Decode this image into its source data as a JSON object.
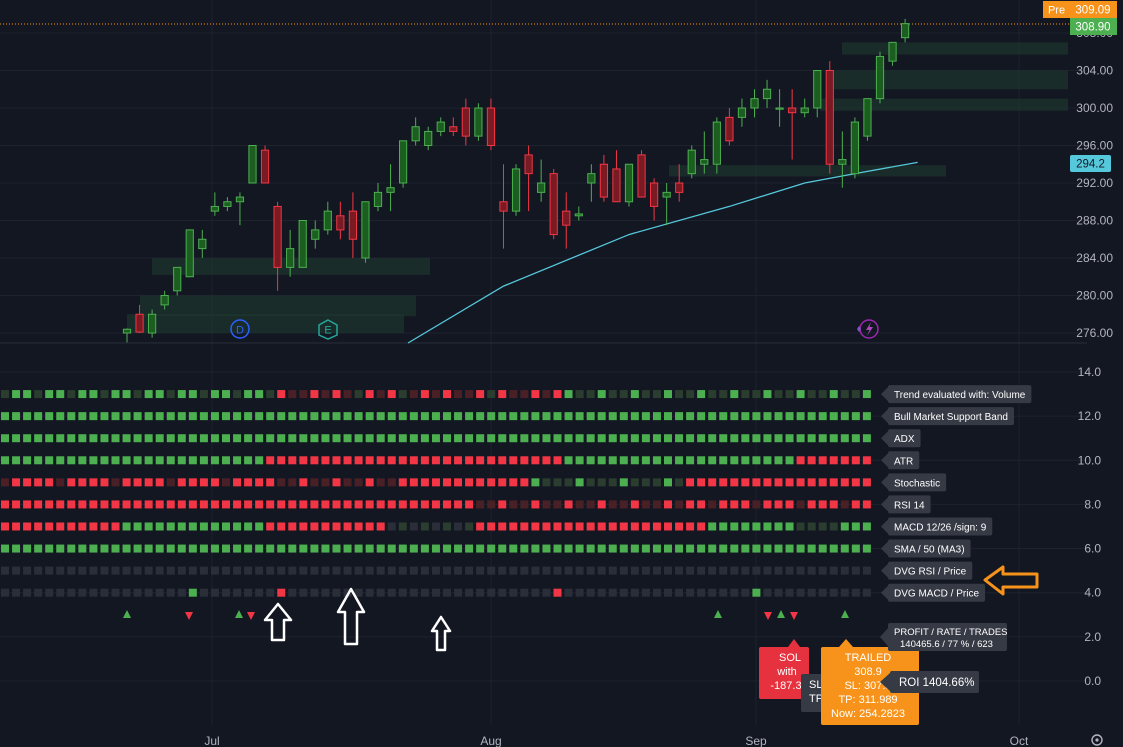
{
  "price_axis": {
    "ticks": [
      "308.00",
      "304.00",
      "300.00",
      "296.00",
      "292.00",
      "288.00",
      "284.00",
      "280.00",
      "276.00"
    ],
    "pre_tag": "Pre",
    "pre_price": "309.09",
    "last_price": "308.90",
    "ma_price": "294.2"
  },
  "indicator_axis": {
    "ticks": [
      "14.0",
      "12.0",
      "10.0",
      "8.0",
      "6.0",
      "4.0",
      "2.0",
      "0.0"
    ]
  },
  "time_axis": [
    "Jul",
    "Aug",
    "Sep",
    "Oct"
  ],
  "markers": {
    "dividend": "D",
    "earnings": "E"
  },
  "indicator_rows": [
    "Trend evaluated with: Volume",
    "Bull Market Support Band",
    "ADX",
    "ATR",
    "Stochastic",
    "RSI 14",
    "MACD  12/26 /sign: 9",
    "SMA / 50 (MA3)",
    "DVG RSI / Price",
    "DVG MACD / Price"
  ],
  "stats": {
    "profit_label": "PROFIT / RATE / TRADES",
    "profit_value": "140465.6 / 77 % / 623",
    "roi": "ROI 1404.66%"
  },
  "trade_labels": {
    "sold_lines": [
      "SOL",
      "with",
      "-187.3"
    ],
    "sl_lines": [
      "SL",
      "TP"
    ],
    "trailed_lines": [
      "TRAILED",
      "308.9",
      "SL: 307.3",
      "TP: 311.989",
      "Now: 254.2823"
    ]
  },
  "colors": {
    "background": "#131722",
    "bull": "#4caf50",
    "bear": "#f23645",
    "ma_line": "#56c8dc",
    "trailed": "#f7931a",
    "arrow": "#f7931a"
  },
  "chart_data": {
    "type": "candlestick",
    "x_axis_ticks": [
      "Jul",
      "Aug",
      "Sep",
      "Oct"
    ],
    "y_axis_ticks": [
      276,
      280,
      284,
      288,
      292,
      296,
      300,
      304,
      308
    ],
    "candles": [
      {
        "o": 276,
        "h": 276.5,
        "l": 275,
        "c": 276.4
      },
      {
        "o": 278,
        "h": 279,
        "l": 276,
        "c": 276.1
      },
      {
        "o": 276,
        "h": 278.5,
        "l": 275.5,
        "c": 278
      },
      {
        "o": 279,
        "h": 280.5,
        "l": 278.5,
        "c": 280
      },
      {
        "o": 280.5,
        "h": 283,
        "l": 280,
        "c": 283
      },
      {
        "o": 282,
        "h": 287,
        "l": 282,
        "c": 287
      },
      {
        "o": 285,
        "h": 287,
        "l": 284,
        "c": 286
      },
      {
        "o": 289,
        "h": 291,
        "l": 288.5,
        "c": 289.5
      },
      {
        "o": 289.5,
        "h": 290.5,
        "l": 289,
        "c": 290
      },
      {
        "o": 290,
        "h": 291,
        "l": 287.5,
        "c": 290.5
      },
      {
        "o": 292,
        "h": 296,
        "l": 292,
        "c": 296
      },
      {
        "o": 295.5,
        "h": 296,
        "l": 292,
        "c": 292
      },
      {
        "o": 289.5,
        "h": 290,
        "l": 280.5,
        "c": 283
      },
      {
        "o": 283,
        "h": 287,
        "l": 282,
        "c": 285
      },
      {
        "o": 283,
        "h": 288,
        "l": 283,
        "c": 288
      },
      {
        "o": 286,
        "h": 288,
        "l": 285,
        "c": 287
      },
      {
        "o": 287,
        "h": 290,
        "l": 286.5,
        "c": 289
      },
      {
        "o": 288.5,
        "h": 290,
        "l": 286,
        "c": 287
      },
      {
        "o": 289,
        "h": 291,
        "l": 284,
        "c": 286
      },
      {
        "o": 284,
        "h": 290,
        "l": 283.5,
        "c": 290
      },
      {
        "o": 289.5,
        "h": 292,
        "l": 289,
        "c": 291
      },
      {
        "o": 291,
        "h": 294,
        "l": 289,
        "c": 291.5
      },
      {
        "o": 292,
        "h": 296.5,
        "l": 291.5,
        "c": 296.5
      },
      {
        "o": 296.5,
        "h": 299,
        "l": 296,
        "c": 298
      },
      {
        "o": 296,
        "h": 298,
        "l": 295.5,
        "c": 297.5
      },
      {
        "o": 297.5,
        "h": 299,
        "l": 297,
        "c": 298.5
      },
      {
        "o": 298,
        "h": 299,
        "l": 297,
        "c": 297.5
      },
      {
        "o": 300,
        "h": 301,
        "l": 296,
        "c": 297
      },
      {
        "o": 297,
        "h": 300.5,
        "l": 296.5,
        "c": 300
      },
      {
        "o": 300,
        "h": 301,
        "l": 295.5,
        "c": 296
      },
      {
        "o": 290,
        "h": 294,
        "l": 285,
        "c": 289
      },
      {
        "o": 289,
        "h": 294,
        "l": 288.5,
        "c": 293.5
      },
      {
        "o": 295,
        "h": 296,
        "l": 289,
        "c": 293
      },
      {
        "o": 291,
        "h": 294.5,
        "l": 290,
        "c": 292
      },
      {
        "o": 293,
        "h": 293.5,
        "l": 286,
        "c": 286.5
      },
      {
        "o": 289,
        "h": 291,
        "l": 285,
        "c": 287.5
      },
      {
        "o": 288.5,
        "h": 289.5,
        "l": 288,
        "c": 288.7
      },
      {
        "o": 292,
        "h": 294,
        "l": 290,
        "c": 293
      },
      {
        "o": 294,
        "h": 295,
        "l": 290,
        "c": 290.5
      },
      {
        "o": 293.5,
        "h": 295.5,
        "l": 290,
        "c": 290
      },
      {
        "o": 290,
        "h": 294,
        "l": 289.5,
        "c": 294
      },
      {
        "o": 295,
        "h": 295.5,
        "l": 290.5,
        "c": 290.5
      },
      {
        "o": 292,
        "h": 292.5,
        "l": 288,
        "c": 289.5
      },
      {
        "o": 290.5,
        "h": 292,
        "l": 287.5,
        "c": 291
      },
      {
        "o": 292,
        "h": 294,
        "l": 290,
        "c": 291
      },
      {
        "o": 293,
        "h": 296,
        "l": 292.5,
        "c": 295.5
      },
      {
        "o": 294,
        "h": 297.5,
        "l": 293,
        "c": 294.5
      },
      {
        "o": 294,
        "h": 299,
        "l": 293,
        "c": 298.5
      },
      {
        "o": 299,
        "h": 300,
        "l": 296,
        "c": 296.5
      },
      {
        "o": 299,
        "h": 301,
        "l": 298,
        "c": 300
      },
      {
        "o": 300,
        "h": 302,
        "l": 299,
        "c": 301
      },
      {
        "o": 301,
        "h": 303,
        "l": 300,
        "c": 302
      },
      {
        "o": 300,
        "h": 302,
        "l": 298,
        "c": 300
      },
      {
        "o": 300,
        "h": 302,
        "l": 294.5,
        "c": 299.5
      },
      {
        "o": 299.5,
        "h": 301,
        "l": 299,
        "c": 300
      },
      {
        "o": 300,
        "h": 304,
        "l": 299,
        "c": 304
      },
      {
        "o": 304,
        "h": 305,
        "l": 293,
        "c": 294
      },
      {
        "o": 294,
        "h": 297.5,
        "l": 291.5,
        "c": 294.5
      },
      {
        "o": 293,
        "h": 299,
        "l": 292.5,
        "c": 298.5
      },
      {
        "o": 297,
        "h": 301,
        "l": 296.5,
        "c": 301
      },
      {
        "o": 301,
        "h": 306,
        "l": 300.5,
        "c": 305.5
      },
      {
        "o": 305,
        "h": 307,
        "l": 304.5,
        "c": 307
      },
      {
        "o": 307.5,
        "h": 309.5,
        "l": 307,
        "c": 309
      }
    ],
    "ma_line": [
      {
        "i": 21,
        "v": 276.0
      },
      {
        "i": 30,
        "v": 281.0
      },
      {
        "i": 40,
        "v": 286.5
      },
      {
        "i": 48,
        "v": 289.5
      },
      {
        "i": 54,
        "v": 292.0
      },
      {
        "i": 58,
        "v": 293.0
      },
      {
        "i": 63,
        "v": 294.2
      }
    ],
    "indicator_rows": [
      {
        "name": "Trend evaluated with: Volume",
        "level": 13
      },
      {
        "name": "Bull Market Support Band",
        "level": 12
      },
      {
        "name": "ADX",
        "level": 11
      },
      {
        "name": "ATR",
        "level": 10
      },
      {
        "name": "Stochastic",
        "level": 9
      },
      {
        "name": "RSI 14",
        "level": 8
      },
      {
        "name": "MACD  12/26 /sign: 9",
        "level": 7
      },
      {
        "name": "SMA / 50 (MA3)",
        "level": 6
      },
      {
        "name": "DVG RSI / Price",
        "level": 5
      },
      {
        "name": "DVG MACD / Price",
        "level": 4
      }
    ]
  }
}
